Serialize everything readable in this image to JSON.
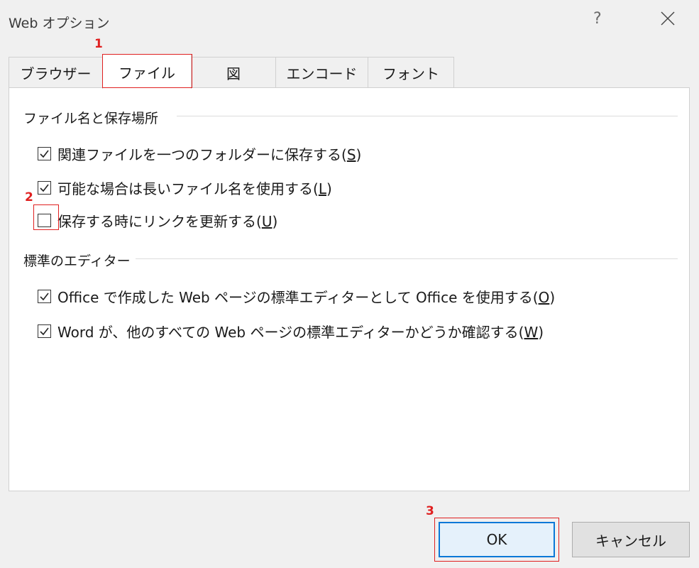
{
  "window": {
    "title": "Web オプション",
    "help_label": "?"
  },
  "tabs": [
    {
      "label": "ブラウザー",
      "active": false
    },
    {
      "label": "ファイル",
      "active": true
    },
    {
      "label": "図",
      "active": false
    },
    {
      "label": "エンコード",
      "active": false
    },
    {
      "label": "フォント",
      "active": false
    }
  ],
  "groups": {
    "file_names": {
      "title": "ファイル名と保存場所",
      "items": [
        {
          "text": "関連ファイルを一つのフォルダーに保存する(",
          "key": "S",
          "close": ")",
          "checked": true
        },
        {
          "text": "可能な場合は長いファイル名を使用する(",
          "key": "L",
          "close": ")",
          "checked": true
        },
        {
          "text": "保存する時にリンクを更新する(",
          "key": "U",
          "close": ")",
          "checked": false
        }
      ]
    },
    "default_editor": {
      "title": "標準のエディター",
      "items": [
        {
          "text": "Office で作成した Web ページの標準エディターとして Office を使用する(",
          "key": "O",
          "close": ")",
          "checked": true
        },
        {
          "text": "Word が、他のすべての Web ページの標準エディターかどうか確認する(",
          "key": "W",
          "close": ")",
          "checked": true
        }
      ]
    }
  },
  "buttons": {
    "ok": "OK",
    "cancel": "キャンセル"
  },
  "annotations": [
    "1",
    "2",
    "3"
  ],
  "colors": {
    "highlight": "#e02020",
    "ok_border": "#0a78d7",
    "ok_fill": "#e5f1fb"
  }
}
